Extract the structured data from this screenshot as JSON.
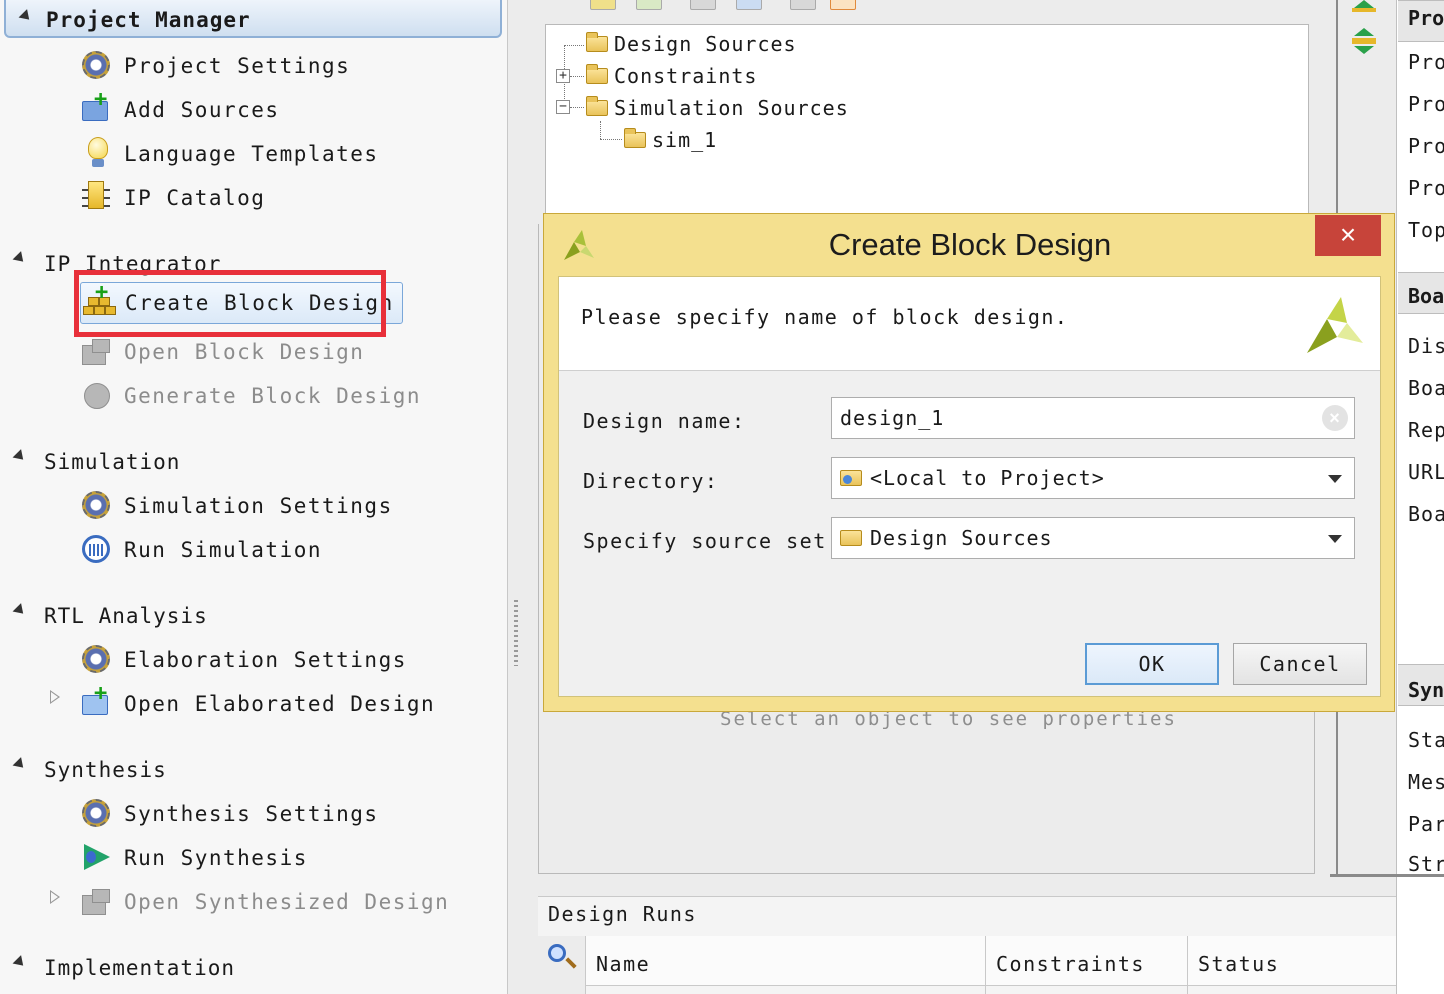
{
  "flow_navigator": {
    "header_title": "Project Manager",
    "project_manager_items": [
      {
        "label": "Project Settings",
        "icon": "gear-icon"
      },
      {
        "label": "Add Sources",
        "icon": "add-sources-icon"
      },
      {
        "label": "Language Templates",
        "icon": "lightbulb-icon"
      },
      {
        "label": "IP Catalog",
        "icon": "ip-catalog-icon"
      }
    ],
    "ip_integrator": {
      "title": "IP Integrator",
      "items": [
        {
          "label": "Create Block Design",
          "icon": "create-block-design-icon",
          "enabled": true
        },
        {
          "label": "Open Block Design",
          "icon": "open-block-design-icon",
          "enabled": false
        },
        {
          "label": "Generate Block Design",
          "icon": "generate-block-design-icon",
          "enabled": false
        }
      ]
    },
    "simulation": {
      "title": "Simulation",
      "items": [
        {
          "label": "Simulation Settings",
          "icon": "gear-icon"
        },
        {
          "label": "Run Simulation",
          "icon": "run-simulation-icon"
        }
      ]
    },
    "rtl_analysis": {
      "title": "RTL Analysis",
      "items": [
        {
          "label": "Elaboration Settings",
          "icon": "gear-icon"
        },
        {
          "label": "Open Elaborated Design",
          "icon": "open-elaborated-design-icon"
        }
      ]
    },
    "synthesis": {
      "title": "Synthesis",
      "items": [
        {
          "label": "Synthesis Settings",
          "icon": "gear-icon"
        },
        {
          "label": "Run Synthesis",
          "icon": "run-synthesis-icon"
        },
        {
          "label": "Open Synthesized Design",
          "icon": "open-synthesized-design-icon",
          "enabled": false
        }
      ]
    },
    "implementation": {
      "title": "Implementation"
    }
  },
  "sources_tree": {
    "items": [
      "Design Sources",
      "Constraints",
      "Simulation Sources",
      "sim_1"
    ]
  },
  "properties": {
    "empty_text": "Select an object to see properties"
  },
  "design_runs": {
    "title": "Design Runs",
    "columns": [
      "Name",
      "Constraints",
      "Status"
    ]
  },
  "right_panel": {
    "project_summary_rows": [
      "Pro",
      "Pro",
      "Pro",
      "Pro",
      "Pro",
      "Top"
    ],
    "board_header": "Boa",
    "board_rows": [
      "Dis",
      "Boa",
      "Rep",
      "URL",
      "Boa"
    ],
    "synth_header": "Syn",
    "synth_rows": [
      "Sta",
      "Mes",
      "Par",
      "Str"
    ]
  },
  "dialog": {
    "title": "Create Block Design",
    "close_label": "×",
    "prompt": "Please specify name of block design.",
    "design_name_label": "Design name:",
    "design_name_value": "design_1",
    "directory_label": "Directory:",
    "directory_value": "<Local to Project>",
    "source_set_label": "Specify source set:",
    "source_set_value": "Design Sources",
    "ok_label": "OK",
    "cancel_label": "Cancel"
  },
  "colors": {
    "dialog_bg": "#f4e08f",
    "close_button": "#c7443a",
    "highlight": "#e8303a",
    "ok_border": "#5b9bd5"
  }
}
